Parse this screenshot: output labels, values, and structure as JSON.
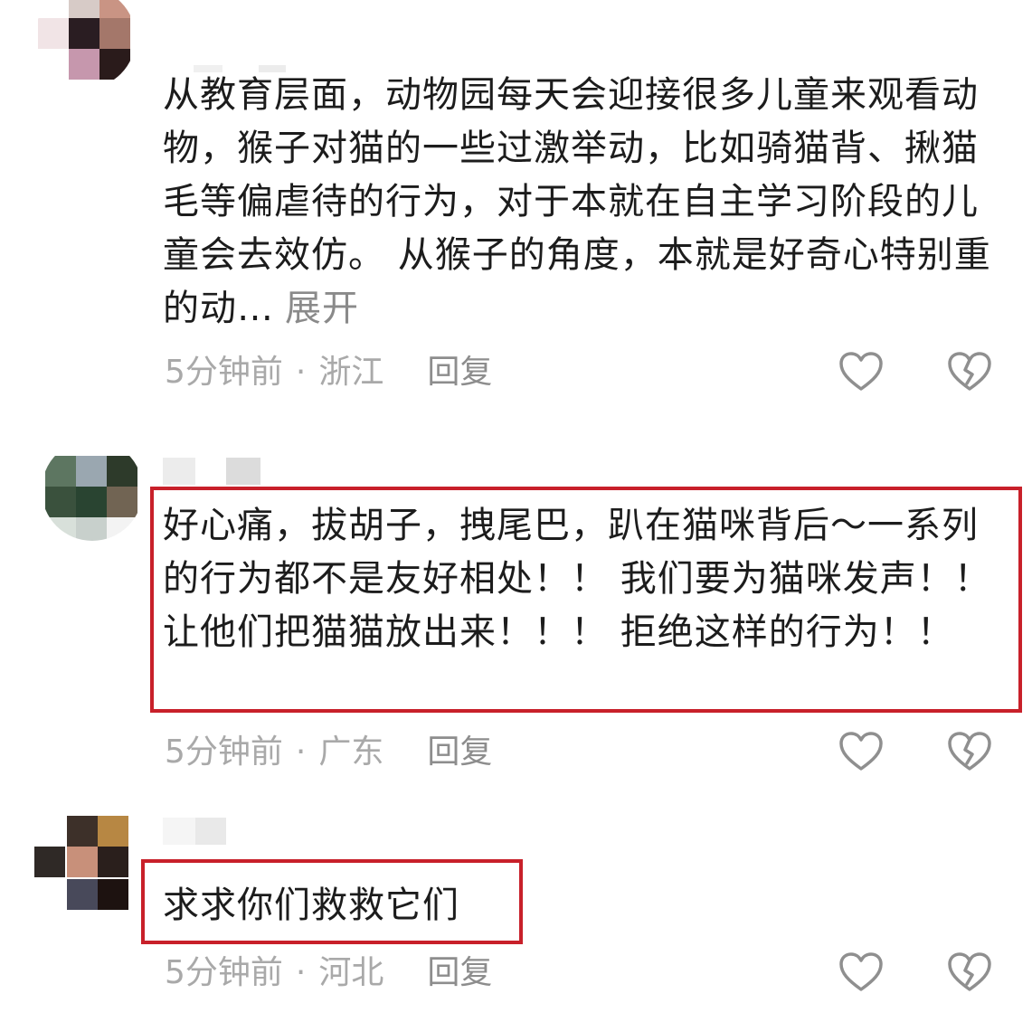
{
  "comments": [
    {
      "text": "从教育层面，动物园每天会迎接很多儿童来观看动物，猴子对猫的一些过激举动，比如骑猫背、揪猫毛等偏虐待的行为，对于本就在自主学习阶段的儿童会去效仿。 从猴子的角度，本就是好奇心特别重的动…",
      "expand_label": "展开",
      "time": "5分钟前",
      "separator": "·",
      "location": "浙江",
      "reply_label": "回复"
    },
    {
      "text": "好心痛，拔胡子，拽尾巴，趴在猫咪背后～一系列的行为都不是友好相处！！ 我们要为猫咪发声！！ 让他们把猫猫放出来！！！ 拒绝这样的行为！！",
      "time": "5分钟前",
      "separator": "·",
      "location": "广东",
      "reply_label": "回复"
    },
    {
      "text": "求求你们救救它们",
      "time": "5分钟前",
      "separator": "·",
      "location": "河北",
      "reply_label": "回复"
    }
  ],
  "colors": {
    "highlight_border": "#c8202a",
    "text": "#1c1c1c",
    "meta": "#a9a9a9",
    "icon_stroke": "#8f8f8f"
  },
  "icons": [
    "heart-outline-icon",
    "broken-heart-icon"
  ]
}
